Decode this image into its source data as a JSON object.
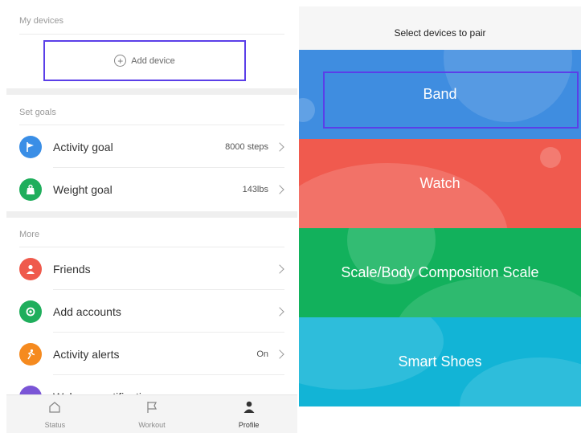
{
  "left": {
    "sections": {
      "my_devices": "My devices",
      "set_goals": "Set goals",
      "more": "More"
    },
    "add_device": {
      "label": "Add device"
    },
    "goals": [
      {
        "label": "Activity goal",
        "value": "8000 steps",
        "color": "#3a8ee6"
      },
      {
        "label": "Weight goal",
        "value": "143lbs",
        "color": "#1fae5c"
      }
    ],
    "more_items": [
      {
        "label": "Friends",
        "value": "",
        "color": "#ef5a4c"
      },
      {
        "label": "Add accounts",
        "value": "",
        "color": "#1fae5c"
      },
      {
        "label": "Activity alerts",
        "value": "On",
        "color": "#f58a1f"
      }
    ],
    "partial_item": {
      "label": "Wake up notifications",
      "color": "#7a55d6"
    },
    "tabs": [
      {
        "label": "Status",
        "icon": "home-icon"
      },
      {
        "label": "Workout",
        "icon": "flag-icon"
      },
      {
        "label": "Profile",
        "icon": "person-icon"
      }
    ]
  },
  "right": {
    "title": "Select devices to pair",
    "devices": [
      {
        "label": "Band",
        "color": "#3f8de0"
      },
      {
        "label": "Watch",
        "color": "#f05a4e"
      },
      {
        "label": "Scale/Body Composition Scale",
        "color": "#12b15c"
      },
      {
        "label": "Smart Shoes",
        "color": "#12b4d6"
      }
    ]
  },
  "colors": {
    "highlight": "#5b3fe8"
  }
}
